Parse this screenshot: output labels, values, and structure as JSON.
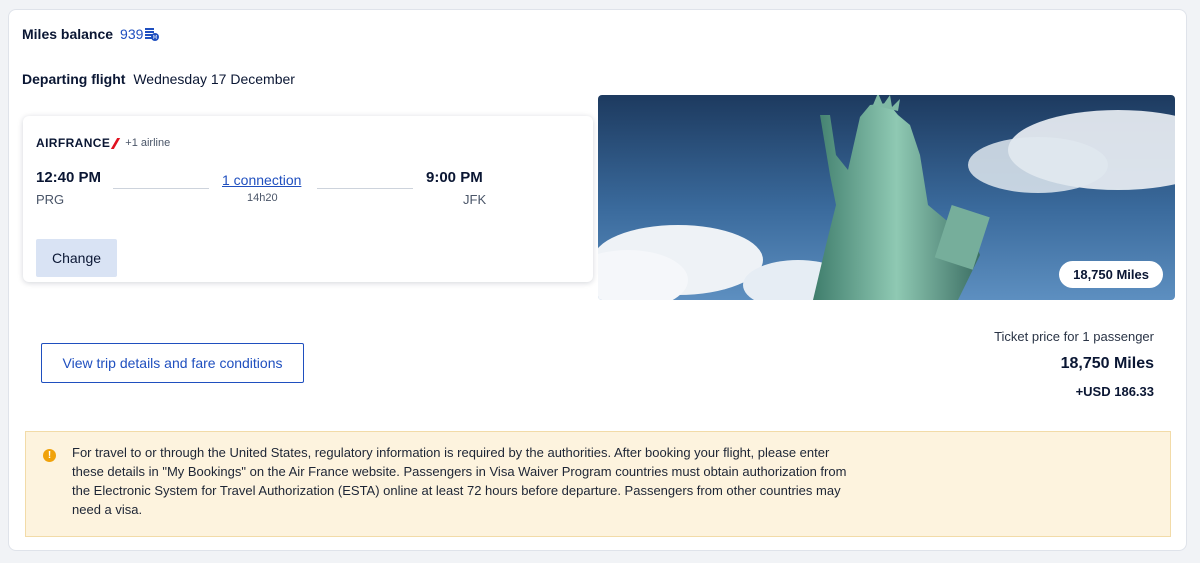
{
  "miles": {
    "label": "Miles balance",
    "value": "939"
  },
  "departing": {
    "label": "Departing flight",
    "date": "Wednesday 17 December"
  },
  "flight": {
    "airline_logo": "AIRFRANCE",
    "extra_airline": "+1 airline",
    "depart_time": "12:40 PM",
    "depart_code": "PRG",
    "arrive_time": "9:00 PM",
    "arrive_code": "JFK",
    "connection": "1 connection",
    "duration": "14h20",
    "change_label": "Change"
  },
  "hero": {
    "badge": "18,750 Miles",
    "subject": "statue-of-liberty"
  },
  "price": {
    "label": "Ticket price for 1 passenger",
    "miles": "18,750 Miles",
    "usd": "+USD 186.33"
  },
  "trip_details_label": "View trip details and fare conditions",
  "notice": {
    "icon": "warning-icon",
    "text": "For travel to or through the United States, regulatory information is required by the authorities. After booking your flight, please enter these details in \"My Bookings\" on the Air France website. Passengers in Visa Waiver Program countries must obtain authorization from the Electronic System for Travel Authorization (ESTA) online at least 72 hours before departure. Passengers from other countries may need a visa."
  },
  "colors": {
    "accent": "#1f4fbf",
    "brand_red": "#e0111f",
    "notice_bg": "#fdf3de"
  }
}
